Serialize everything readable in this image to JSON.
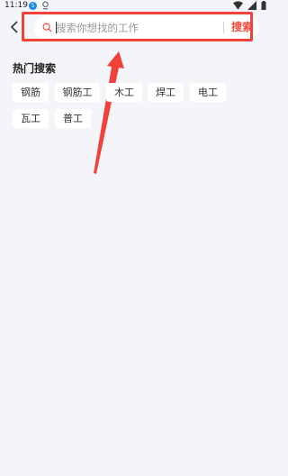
{
  "status_bar": {
    "time": "11:19",
    "badge": "5"
  },
  "search": {
    "placeholder": "搜索你想找的工作",
    "value": "",
    "button_label": "搜索"
  },
  "hot_search": {
    "title": "热门搜索",
    "tags": [
      "钢筋",
      "钢筋工",
      "木工",
      "焊工",
      "电工",
      "瓦工",
      "普工"
    ]
  },
  "colors": {
    "accent": "#f24a3c",
    "annotation": "#f0413a",
    "background": "#f4f5f9"
  },
  "icons": [
    "back-arrow-icon",
    "search-icon",
    "wifi-icon",
    "signal-icon",
    "battery-icon"
  ]
}
